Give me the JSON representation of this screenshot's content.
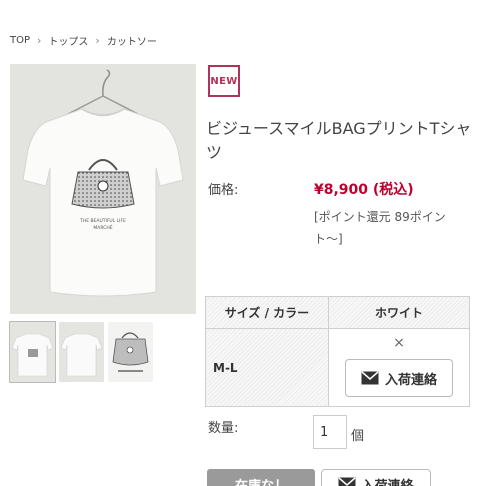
{
  "breadcrumb": {
    "items": [
      "TOP",
      "トップス",
      "カットソー"
    ],
    "separator": ">"
  },
  "product": {
    "badge": "NEW",
    "title": "ビジュースマイルBAGプリントTシャツ",
    "price_label": "価格:",
    "price": "¥8,900 (税込)",
    "points": "[ポイント還元 89ポイント〜]"
  },
  "stock_table": {
    "header_size_color": "サイズ / カラー",
    "header_color": "ホワイト",
    "rows": [
      {
        "size": "M-L",
        "stock_mark": "×",
        "notify_label": "入荷連絡"
      }
    ]
  },
  "quantity": {
    "label": "数量:",
    "value": "1",
    "unit": "個"
  },
  "actions": {
    "out_of_stock_label": "在庫なし",
    "notify_label": "入荷連絡"
  },
  "colors": {
    "badge": "#b0345a",
    "price": "#c0002e",
    "disabled_button": "#9a9a9a"
  },
  "icons": {
    "breadcrumb_separator": "chevron-right-icon",
    "notify": "mail-icon"
  }
}
